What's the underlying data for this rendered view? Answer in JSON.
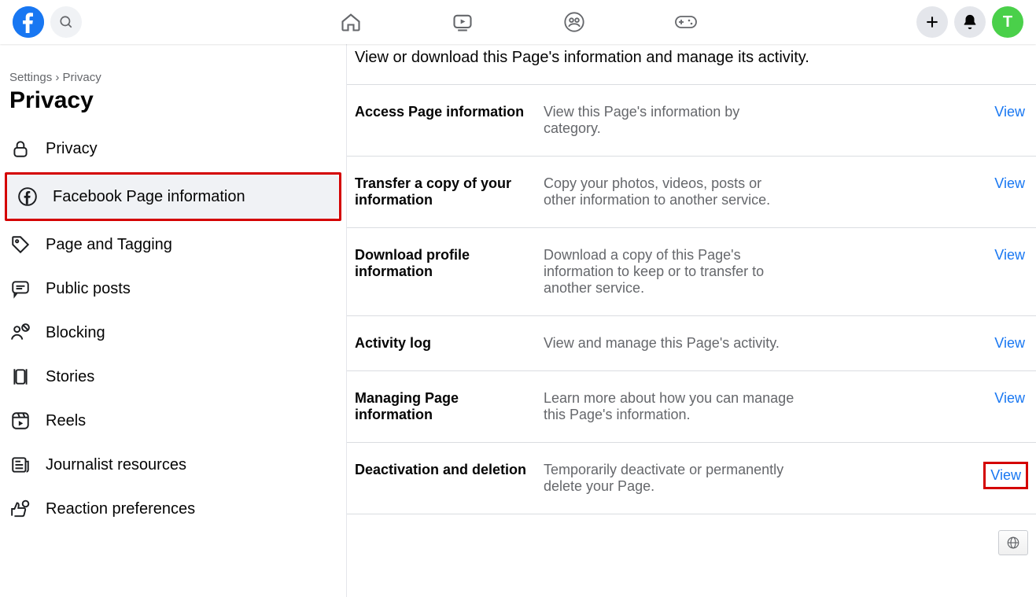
{
  "header": {
    "avatar_initial": "T"
  },
  "breadcrumb": {
    "parent": "Settings",
    "sep": "›",
    "current": "Privacy"
  },
  "page_title": "Privacy",
  "sidebar": {
    "items": [
      {
        "label": "Privacy"
      },
      {
        "label": "Facebook Page information"
      },
      {
        "label": "Page and Tagging"
      },
      {
        "label": "Public posts"
      },
      {
        "label": "Blocking"
      },
      {
        "label": "Stories"
      },
      {
        "label": "Reels"
      },
      {
        "label": "Journalist resources"
      },
      {
        "label": "Reaction preferences"
      }
    ]
  },
  "intro": "View or download this Page's information and manage its activity.",
  "settings": [
    {
      "title": "Access Page information",
      "desc": "View this Page's information by category.",
      "action": "View"
    },
    {
      "title": "Transfer a copy of your information",
      "desc": "Copy your photos, videos, posts or other information to another service.",
      "action": "View"
    },
    {
      "title": "Download profile information",
      "desc": "Download a copy of this Page's information to keep or to transfer to another service.",
      "action": "View"
    },
    {
      "title": "Activity log",
      "desc": "View and manage this Page's activity.",
      "action": "View"
    },
    {
      "title": "Managing Page information",
      "desc": "Learn more about how you can manage this Page's information.",
      "action": "View"
    },
    {
      "title": "Deactivation and deletion",
      "desc": "Temporarily deactivate or permanently delete your Page.",
      "action": "View"
    }
  ]
}
